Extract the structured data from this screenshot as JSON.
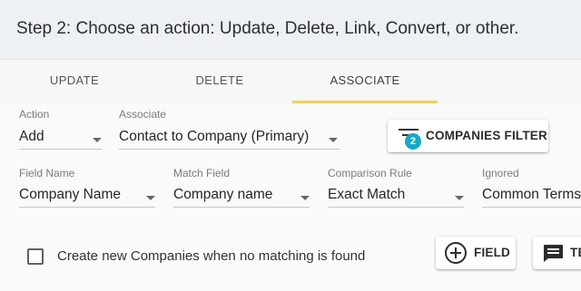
{
  "header": {
    "title": "Step 2: Choose an action: Update, Delete, Link, Convert, or other."
  },
  "tabs": [
    {
      "label": "UPDATE",
      "active": false
    },
    {
      "label": "DELETE",
      "active": false
    },
    {
      "label": "ASSOCIATE",
      "active": true
    }
  ],
  "accent_color": "#f2d34f",
  "badge_color": "#17a8c6",
  "row1": {
    "action": {
      "label": "Action",
      "value": "Add"
    },
    "associate": {
      "label": "Associate",
      "value": "Contact to Company (Primary)"
    },
    "filter_button": {
      "label": "COMPANIES FILTER",
      "badge": "2",
      "icon": "filter-list-icon"
    }
  },
  "row2": {
    "field_name": {
      "label": "Field Name",
      "value": "Company Name"
    },
    "match_field": {
      "label": "Match Field",
      "value": "Company name"
    },
    "comparison_rule": {
      "label": "Comparison Rule",
      "value": "Exact Match"
    },
    "ignored": {
      "label": "Ignored",
      "value": "Common Terms"
    }
  },
  "footer": {
    "checkbox_label": "Create new Companies when no matching is found",
    "checkbox_checked": false,
    "field_button": {
      "label": "FIELD",
      "icon": "add-circle-icon"
    },
    "text_button": {
      "label": "TEXT",
      "icon": "message-icon"
    }
  }
}
